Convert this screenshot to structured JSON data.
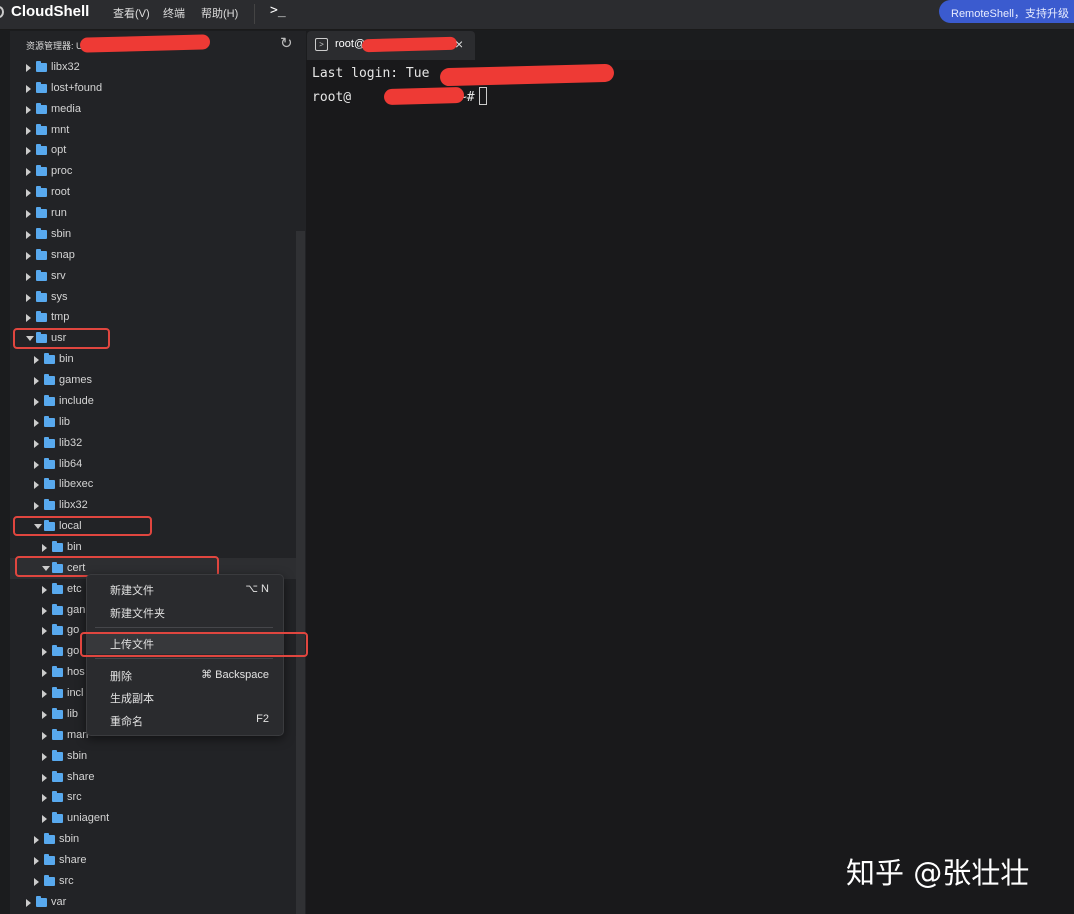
{
  "app": {
    "title": "CloudShell",
    "menus": [
      "查看(V)",
      "终端",
      "帮助(H)"
    ],
    "terminal_button": ">_",
    "banner": "RemoteShell，支持升级"
  },
  "sidebar": {
    "title": "资源管理器: U",
    "refresh_icon": "refresh-icon",
    "tree": [
      {
        "label": "libx32",
        "level": 0,
        "open": false
      },
      {
        "label": "lost+found",
        "level": 0,
        "open": false
      },
      {
        "label": "media",
        "level": 0,
        "open": false
      },
      {
        "label": "mnt",
        "level": 0,
        "open": false
      },
      {
        "label": "opt",
        "level": 0,
        "open": false
      },
      {
        "label": "proc",
        "level": 0,
        "open": false
      },
      {
        "label": "root",
        "level": 0,
        "open": false
      },
      {
        "label": "run",
        "level": 0,
        "open": false
      },
      {
        "label": "sbin",
        "level": 0,
        "open": false
      },
      {
        "label": "snap",
        "level": 0,
        "open": false
      },
      {
        "label": "srv",
        "level": 0,
        "open": false
      },
      {
        "label": "sys",
        "level": 0,
        "open": false
      },
      {
        "label": "tmp",
        "level": 0,
        "open": false
      },
      {
        "label": "usr",
        "level": 0,
        "open": true
      },
      {
        "label": "bin",
        "level": 1,
        "open": false
      },
      {
        "label": "games",
        "level": 1,
        "open": false
      },
      {
        "label": "include",
        "level": 1,
        "open": false
      },
      {
        "label": "lib",
        "level": 1,
        "open": false
      },
      {
        "label": "lib32",
        "level": 1,
        "open": false
      },
      {
        "label": "lib64",
        "level": 1,
        "open": false
      },
      {
        "label": "libexec",
        "level": 1,
        "open": false
      },
      {
        "label": "libx32",
        "level": 1,
        "open": false
      },
      {
        "label": "local",
        "level": 1,
        "open": true
      },
      {
        "label": "bin",
        "level": 2,
        "open": false
      },
      {
        "label": "cert",
        "level": 2,
        "open": true,
        "selected": true
      },
      {
        "label": "etc",
        "level": 2,
        "open": false
      },
      {
        "label": "gan",
        "level": 2,
        "open": false
      },
      {
        "label": "go",
        "level": 2,
        "open": false
      },
      {
        "label": "go",
        "level": 2,
        "open": false
      },
      {
        "label": "hos",
        "level": 2,
        "open": false
      },
      {
        "label": "incl",
        "level": 2,
        "open": false
      },
      {
        "label": "lib",
        "level": 2,
        "open": false
      },
      {
        "label": "man",
        "level": 2,
        "open": false
      },
      {
        "label": "sbin",
        "level": 2,
        "open": false
      },
      {
        "label": "share",
        "level": 2,
        "open": false
      },
      {
        "label": "src",
        "level": 2,
        "open": false
      },
      {
        "label": "uniagent",
        "level": 2,
        "open": false
      },
      {
        "label": "sbin",
        "level": 1,
        "open": false
      },
      {
        "label": "share",
        "level": 1,
        "open": false
      },
      {
        "label": "src",
        "level": 1,
        "open": false
      },
      {
        "label": "var",
        "level": 0,
        "open": false
      }
    ]
  },
  "tab": {
    "label": "root@",
    "close": "×"
  },
  "terminal": {
    "line1": "Last login: Tue ",
    "line2_prefix": "root@",
    "line2_suffix": ":~#"
  },
  "context_menu": {
    "items": [
      {
        "label": "新建文件",
        "shortcut": "⌥ N"
      },
      {
        "label": "新建文件夹",
        "shortcut": ""
      },
      {
        "label": "上传文件",
        "shortcut": "",
        "highlighted": true
      },
      {
        "label": "删除",
        "shortcut": "⌘ Backspace"
      },
      {
        "label": "生成副本",
        "shortcut": ""
      },
      {
        "label": "重命名",
        "shortcut": "F2"
      }
    ]
  },
  "watermark": "知乎 @张壮壮",
  "colors": {
    "accent": "#3b5bcf",
    "folder": "#58a9ee",
    "annotation": "#e0463f"
  }
}
